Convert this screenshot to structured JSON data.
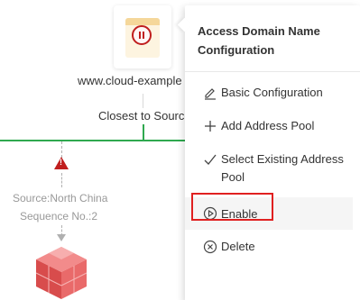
{
  "domain_node": {
    "label": "www.cloud-example",
    "status_icon": "pause-circle-icon"
  },
  "strategy": {
    "label": "Closest to Source"
  },
  "address_pool": {
    "warning_icon": "warning-triangle-icon",
    "warning_symbol": "!",
    "source_label": "Source:North China",
    "sequence_label": "Sequence No.:2"
  },
  "menu": {
    "title": "Access Domain Name Configuration",
    "items": [
      {
        "label": "Basic Configuration",
        "icon": "edit-icon"
      },
      {
        "label": "Add Address Pool",
        "icon": "plus-icon"
      },
      {
        "label": "Select Existing Address Pool",
        "icon": "checkmark-icon"
      },
      {
        "label": "Enable",
        "icon": "play-circle-icon"
      },
      {
        "label": "Delete",
        "icon": "close-circle-icon"
      }
    ]
  },
  "colors": {
    "accent_green": "#2fa84f",
    "alert_red": "#c01e1e",
    "highlight_red": "#e02020"
  }
}
